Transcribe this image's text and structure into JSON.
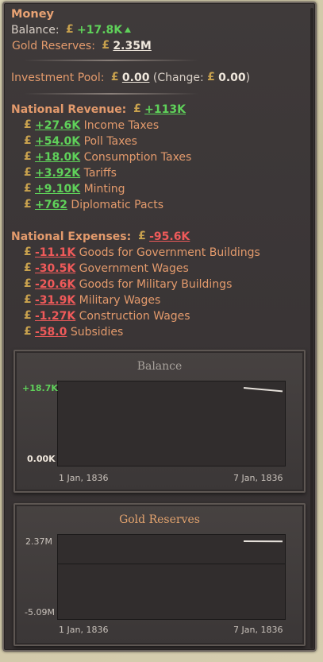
{
  "panel": {
    "title": "Money",
    "balance_label": "Balance:",
    "balance_value": "+17.8K",
    "gold_label": "Gold Reserves:",
    "gold_value": "2.35M",
    "investment_label": "Investment Pool:",
    "investment_value": "0.00",
    "change_prefix": "(Change:",
    "change_value": "0.00",
    "change_suffix": ")"
  },
  "revenue": {
    "title": "National Revenue:",
    "total": "+113K",
    "items": [
      {
        "value": "+27.6K",
        "label": "Income Taxes"
      },
      {
        "value": "+54.0K",
        "label": "Poll Taxes"
      },
      {
        "value": "+18.0K",
        "label": "Consumption Taxes"
      },
      {
        "value": "+3.92K",
        "label": "Tariffs"
      },
      {
        "value": "+9.10K",
        "label": "Minting"
      },
      {
        "value": "+762",
        "label": "Diplomatic Pacts"
      }
    ]
  },
  "expenses": {
    "title": "National Expenses:",
    "total": "-95.6K",
    "items": [
      {
        "value": "-11.1K",
        "label": "Goods for Government Buildings"
      },
      {
        "value": "-30.5K",
        "label": "Government Wages"
      },
      {
        "value": "-20.6K",
        "label": "Goods for Military Buildings"
      },
      {
        "value": "-31.9K",
        "label": "Military Wages"
      },
      {
        "value": "-1.27K",
        "label": "Construction Wages"
      },
      {
        "value": "-58.0",
        "label": "Subsidies"
      }
    ]
  },
  "colors": {
    "positive": "#5fd15a",
    "negative": "#ef5a5a",
    "label": "#e39a6c",
    "gold_icon": "#c9a24e"
  },
  "icons": {
    "currency": "pound-coin-icon",
    "trend": "up-arrow-icon"
  },
  "chart_data": [
    {
      "type": "line",
      "title": "Balance",
      "x": [
        "1 Jan, 1836",
        "7 Jan, 1836"
      ],
      "y_tick_labels": [
        "+18.7K",
        "0.00K"
      ],
      "ylim": [
        0,
        18700
      ],
      "series": [
        {
          "values": [
            18700,
            17800
          ]
        }
      ],
      "grid": false
    },
    {
      "type": "line",
      "title": "Gold Reserves",
      "x": [
        "1 Jan, 1836",
        "7 Jan, 1836"
      ],
      "y_tick_labels": [
        "2.37M",
        "-5.09M"
      ],
      "ylim": [
        -5090000,
        2370000
      ],
      "series": [
        {
          "values": [
            2370000,
            2350000
          ]
        }
      ],
      "grid": false
    }
  ]
}
